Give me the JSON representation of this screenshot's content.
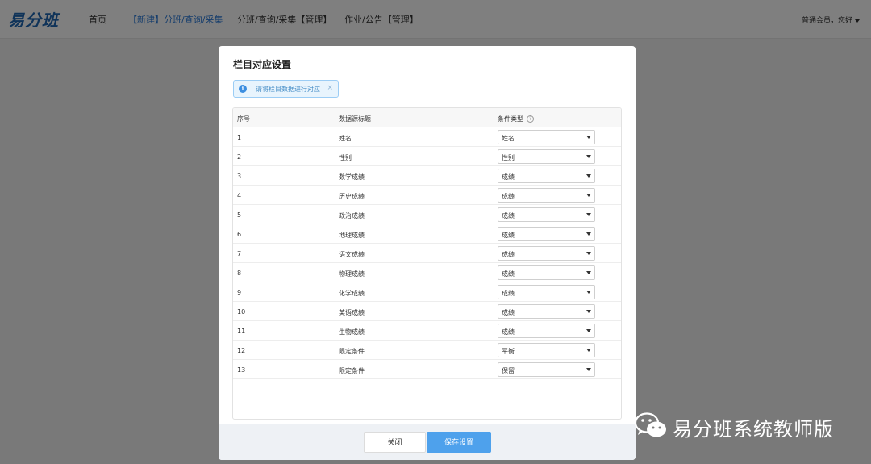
{
  "nav": {
    "logo": "易分班",
    "items": [
      {
        "label": "首页",
        "active": false
      },
      {
        "label": "【新建】分班/查询/采集",
        "active": true
      },
      {
        "label": "分班/查询/采集【管理】",
        "active": false
      },
      {
        "label": "作业/公告【管理】",
        "active": false
      }
    ],
    "user": "普通会员，您好"
  },
  "modal": {
    "title": "栏目对应设置",
    "alert": {
      "text": "请将栏目数据进行对应",
      "close": "×",
      "icon": "info-icon"
    },
    "columns": {
      "index": "序号",
      "source_title": "数据源标题",
      "condition_type": "条件类型",
      "help_icon": "?"
    },
    "rows": [
      {
        "index": "1",
        "title": "姓名",
        "type": "姓名"
      },
      {
        "index": "2",
        "title": "性别",
        "type": "性别"
      },
      {
        "index": "3",
        "title": "数学成绩",
        "type": "成绩"
      },
      {
        "index": "4",
        "title": "历史成绩",
        "type": "成绩"
      },
      {
        "index": "5",
        "title": "政治成绩",
        "type": "成绩"
      },
      {
        "index": "6",
        "title": "地理成绩",
        "type": "成绩"
      },
      {
        "index": "7",
        "title": "语文成绩",
        "type": "成绩"
      },
      {
        "index": "8",
        "title": "物理成绩",
        "type": "成绩"
      },
      {
        "index": "9",
        "title": "化学成绩",
        "type": "成绩"
      },
      {
        "index": "10",
        "title": "英语成绩",
        "type": "成绩"
      },
      {
        "index": "11",
        "title": "生物成绩",
        "type": "成绩"
      },
      {
        "index": "12",
        "title": "限定条件",
        "type": "平衡"
      },
      {
        "index": "13",
        "title": "限定条件",
        "type": "保留"
      }
    ],
    "footer": {
      "close_label": "关闭",
      "save_label": "保存设置"
    }
  },
  "watermark": {
    "text": "易分班系统教师版",
    "icon": "wechat-icon"
  },
  "colors": {
    "brand": "#1f66b3",
    "active_nav": "#2a7ad9",
    "primary_button": "#4ea1ec",
    "alert_bg": "#e8f4fd"
  }
}
